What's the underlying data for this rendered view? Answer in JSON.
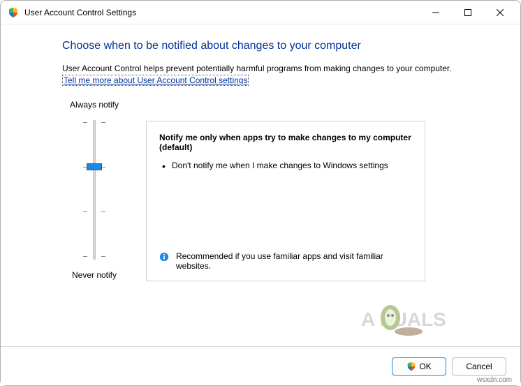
{
  "titlebar": {
    "title": "User Account Control Settings"
  },
  "heading": "Choose when to be notified about changes to your computer",
  "description": "User Account Control helps prevent potentially harmful programs from making changes to your computer.",
  "link_text": "Tell me more about User Account Control settings",
  "slider": {
    "top_label": "Always notify",
    "bottom_label": "Never notify"
  },
  "info": {
    "title": "Notify me only when apps try to make changes to my computer (default)",
    "bullet1": "Don't notify me when I make changes to Windows settings",
    "recommendation": "Recommended if you use familiar apps and visit familiar websites."
  },
  "buttons": {
    "ok": "OK",
    "cancel": "Cancel"
  },
  "watermark_text": "A  PUALS",
  "attribution": "wsxdn.com"
}
